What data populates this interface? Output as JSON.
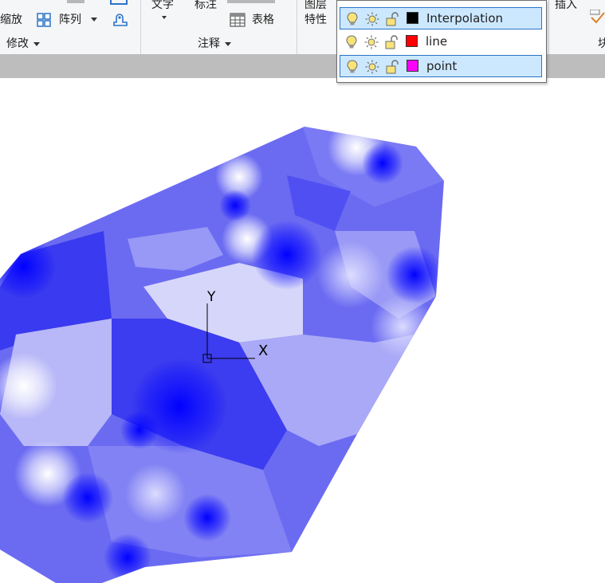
{
  "ribbon": {
    "modify": {
      "zoom_label": "缩放",
      "array_label": "阵列",
      "panel_title": "修改"
    },
    "annotate": {
      "text_label": "文字",
      "dim_label": "标注",
      "table_label": "表格",
      "panel_title": "注释"
    },
    "layers": {
      "properties_label_1": "图层",
      "properties_label_2": "特性"
    },
    "block": {
      "insert_label": "插入",
      "panel_title_partial": "块"
    }
  },
  "layer_dropdown": {
    "layers": [
      {
        "name": "Interpolation",
        "color": "#000000",
        "selected": true
      },
      {
        "name": "line",
        "color": "#ff0000",
        "selected": false
      },
      {
        "name": "point",
        "color": "#ff00ff",
        "selected": true
      }
    ]
  },
  "ucs": {
    "x_label": "X",
    "y_label": "Y"
  },
  "colors": {
    "ribbon_bg": "#f5f6f7",
    "strip": "#bdbdbd",
    "surface_deep": "#0000ff",
    "surface_light": "#ffffff",
    "selection_bg": "#cce8ff",
    "selection_border": "#2a73c7"
  },
  "icons": [
    "array-grid-icon",
    "table-icon",
    "lightbulb-icon",
    "sun-icon",
    "unlock-icon",
    "ucs-origin-icon"
  ]
}
